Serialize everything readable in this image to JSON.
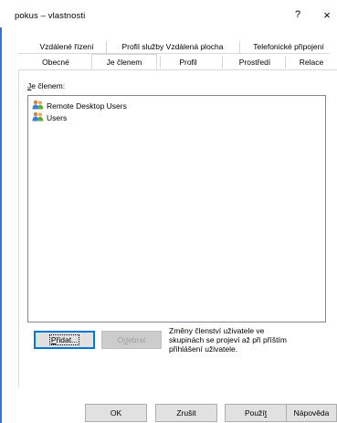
{
  "window": {
    "title": "pokus – vlastnosti",
    "help_symbol": "?",
    "close_symbol": "×"
  },
  "tabs": {
    "row1": [
      {
        "label": "Vzdálené řízení"
      },
      {
        "label": "Profil služby Vzdálená plocha"
      },
      {
        "label": "Telefonické připojení"
      }
    ],
    "row2": [
      {
        "label": "Obecné"
      },
      {
        "label": "Je členem",
        "active": true
      },
      {
        "label": "Profil"
      },
      {
        "label": "Prostředí"
      },
      {
        "label": "Relace"
      }
    ]
  },
  "member_of": {
    "label_underlined": "J",
    "label_rest": "e členem:",
    "items": [
      {
        "name": "Remote Desktop Users",
        "icon": "group-icon"
      },
      {
        "name": "Users",
        "icon": "group-icon"
      }
    ]
  },
  "actions": {
    "add_underlined": "P",
    "add_rest": "řidat...",
    "remove_before": "O",
    "remove_underlined": "d",
    "remove_after": "ebrat"
  },
  "info": {
    "lines": [
      "Změny členství uživatele ve",
      "skupinách se projeví až při příštím",
      "přihlášení uživatele."
    ]
  },
  "footer": {
    "ok": "OK",
    "cancel": "Zrušit",
    "apply_before": "Použí",
    "apply_underlined": "t",
    "help": "Nápověda"
  },
  "colors": {
    "accent": "#0078d7",
    "window_edge": "#3a74c4",
    "button_face": "#e1e1e1"
  }
}
